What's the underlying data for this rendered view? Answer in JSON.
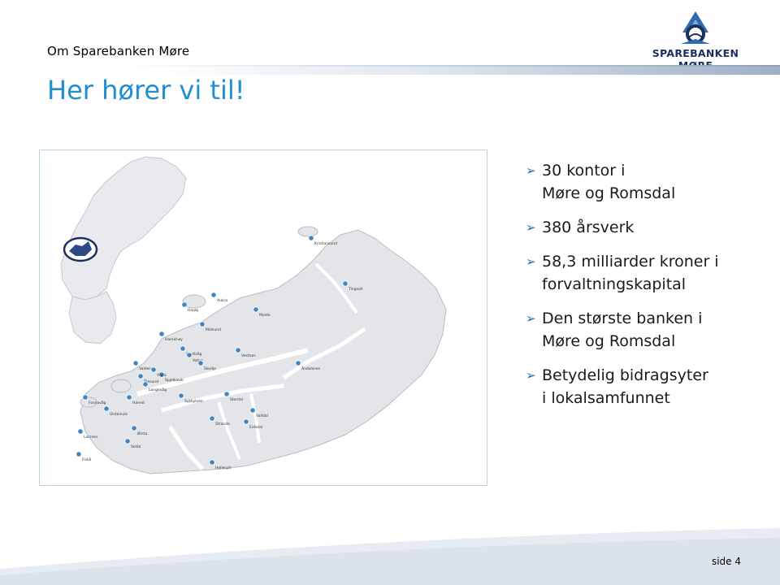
{
  "header": {
    "section_label": "Om Sparebanken Møre",
    "logo_text": "SPAREBANKEN MØRE"
  },
  "slide": {
    "title": "Her hører vi til!",
    "page_label": "side 4"
  },
  "bullets": [
    {
      "lines": [
        "30 kontor i",
        "Møre og Romsdal"
      ]
    },
    {
      "lines": [
        "380 årsverk"
      ]
    },
    {
      "lines": [
        "58,3 milliarder kroner i",
        "forvaltningskapital"
      ]
    },
    {
      "lines": [
        "Den største banken i",
        "Møre og Romsdal"
      ]
    },
    {
      "lines": [
        "Betydelig bidragsyter",
        "i lokalsamfunnet"
      ]
    }
  ],
  "map": {
    "offices": [
      "Kristiansund",
      "Tingvoll",
      "Harøy",
      "Aukra",
      "Molde",
      "Midsund",
      "Hareid-øy",
      "Brattvåg",
      "Vatne",
      "Skodje",
      "Vestnes",
      "Valderøy",
      "Ålesund",
      "Spjelkavik",
      "Langevåg",
      "Åndalsnes",
      "Fosnavåg",
      "Ulsteinvik",
      "Hareid",
      "Sykkylven",
      "Stordal",
      "Stranda",
      "Valldal",
      "Eidsdal",
      "Larsnes",
      "Ørsta",
      "Volda",
      "Fiskå",
      "Hellesylt",
      "Vigra"
    ],
    "colors": {
      "land": "#e3e5e8",
      "land_outline": "#b8bec6",
      "water": "#ffffff",
      "marker": "#3e86c4"
    }
  },
  "colors": {
    "title": "#1f8fd0",
    "arrow": "#2a6fa8",
    "logo": "#1d2f5e"
  }
}
